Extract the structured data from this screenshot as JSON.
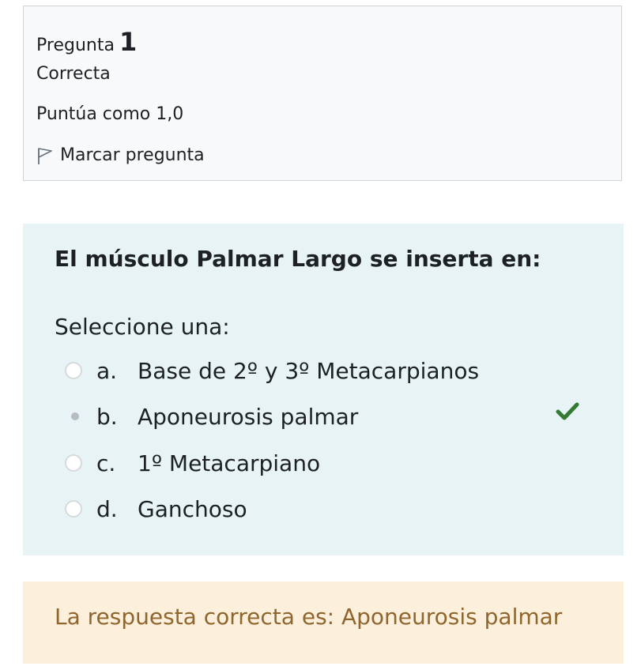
{
  "question_info": {
    "label": "Pregunta",
    "number": "1",
    "state": "Correcta",
    "grade": "Puntúa como 1,0",
    "flag_label": "Marcar pregunta",
    "flag_icon": "flag-outline-icon"
  },
  "question": {
    "text": "El músculo Palmar Largo se inserta en:",
    "prompt": "Seleccione una:",
    "options": [
      {
        "letter": "a.",
        "label": "Base de 2º y 3º Metacarpianos",
        "selected": false
      },
      {
        "letter": "b.",
        "label": "Aponeurosis palmar",
        "selected": true,
        "correct": true
      },
      {
        "letter": "c.",
        "label": "1º Metacarpiano",
        "selected": false
      },
      {
        "letter": "d.",
        "label": "Ganchoso",
        "selected": false
      }
    ],
    "correct_icon": "checkmark-icon"
  },
  "feedback": {
    "text": "La respuesta correcta es: Aponeurosis palmar"
  },
  "colors": {
    "info_bg": "#f8f9fa",
    "question_bg": "#e7f3f5",
    "feedback_bg": "#fcefdc",
    "feedback_text": "#8e662e",
    "check_green": "#357a32"
  }
}
